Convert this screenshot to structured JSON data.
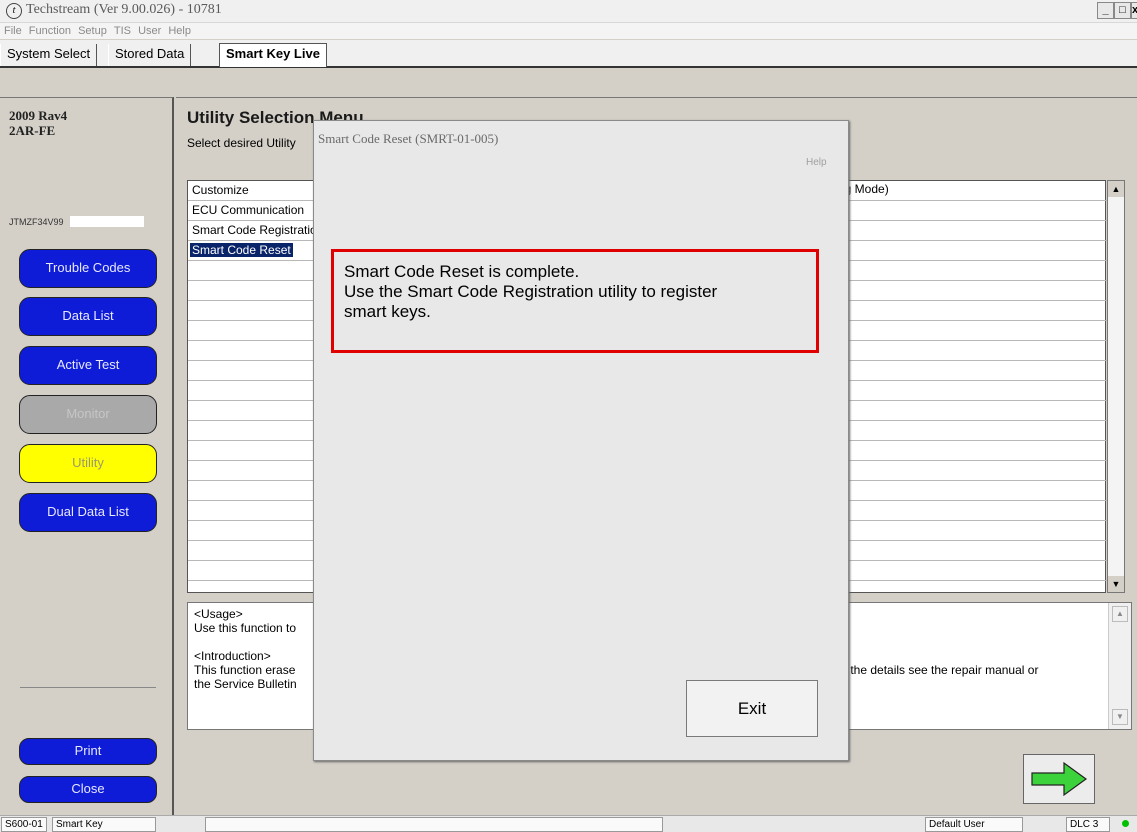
{
  "window": {
    "title": "Techstream (Ver 9.00.026) - 10781",
    "logo_glyph": "t"
  },
  "window_controls": {
    "minimize": "_",
    "maximize": "□",
    "close": "x"
  },
  "menu": [
    "File",
    "Function",
    "Setup",
    "TIS",
    "User",
    "Help"
  ],
  "tabs": [
    {
      "label": "System Select"
    },
    {
      "label": "Stored Data"
    },
    {
      "label": "Smart Key Live"
    }
  ],
  "vehicle": {
    "model": "2009 Rav4",
    "engine": "2AR-FE",
    "vin": "JTMZF34V99"
  },
  "nav": [
    "Trouble Codes",
    "Data List",
    "Active Test",
    "Monitor",
    "Utility",
    "Dual Data List"
  ],
  "bottom_buttons": {
    "print": "Print",
    "close": "Close"
  },
  "main": {
    "title": "Utility Selection Menu",
    "subtitle": "Select desired Utility",
    "mode_header": "ag Mode)",
    "list_items": [
      "Customize",
      "ECU Communication",
      "Smart Code Registration",
      "Smart Code Reset"
    ],
    "selected_index": 3,
    "usage_heading": "<Usage>",
    "usage_text": "Use this function to",
    "intro_heading": "<Introduction>",
    "intro_text_line1": "This function erase",
    "intro_text_line2": "the Service Bulletin",
    "intro_text_tail": "r the details see the repair manual or"
  },
  "dialog": {
    "title": "Smart Code Reset (SMRT-01-005)",
    "help": "Help",
    "message_line1": "Smart Code Reset is complete.",
    "message_line2": "Use the Smart Code Registration utility to register",
    "message_line3": "smart keys.",
    "exit_label": "Exit"
  },
  "status": {
    "screen_id": "S600-01",
    "system": "Smart Key",
    "user": "Default User",
    "dlc": "DLC 3"
  },
  "colors": {
    "nav_blue": "#0e1cd8",
    "utility_yellow": "#ffff00",
    "highlight": "#e00000",
    "connection_dot": "#00c000"
  },
  "icons": {
    "next": "right-arrow-icon",
    "scroll_up": "scroll-up-icon",
    "scroll_down": "scroll-down-icon"
  }
}
